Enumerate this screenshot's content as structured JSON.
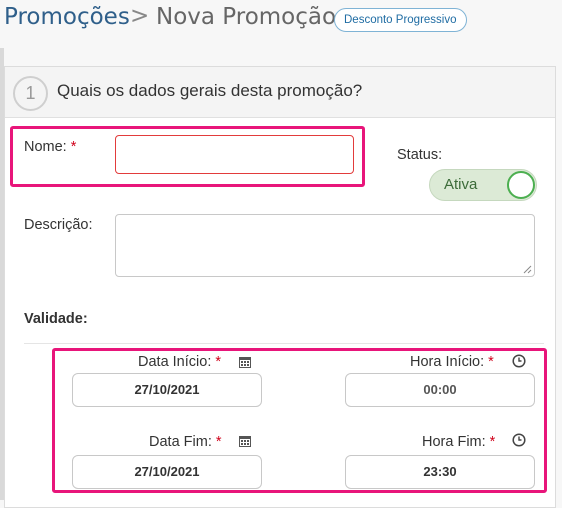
{
  "breadcrumb": {
    "parent": "Promoções",
    "separator": ">",
    "current": "Nova Promoção",
    "badge": "Desconto Progressivo"
  },
  "step": {
    "number": "1",
    "title": "Quais os dados gerais desta promoção?"
  },
  "form": {
    "nome_label": "Nome:",
    "nome_required": "*",
    "nome_value": "",
    "status_label": "Status:",
    "status_value": "Ativa",
    "descricao_label": "Descrição:",
    "descricao_value": "",
    "validade_label": "Validade:",
    "data_inicio_label": "Data Início:",
    "data_inicio_value": "27/10/2021",
    "hora_inicio_label": "Hora Início:",
    "hora_inicio_value": "00:00",
    "data_fim_label": "Data Fim:",
    "data_fim_value": "27/10/2021",
    "hora_fim_label": "Hora Fim:",
    "hora_fim_value": "23:30",
    "required_mark": "*"
  },
  "colors": {
    "highlight": "#e8157a",
    "toggle_on": "#4caf50",
    "link": "#2f5f8a"
  },
  "icons": {
    "date": "calendar-icon",
    "time": "clock-icon"
  }
}
